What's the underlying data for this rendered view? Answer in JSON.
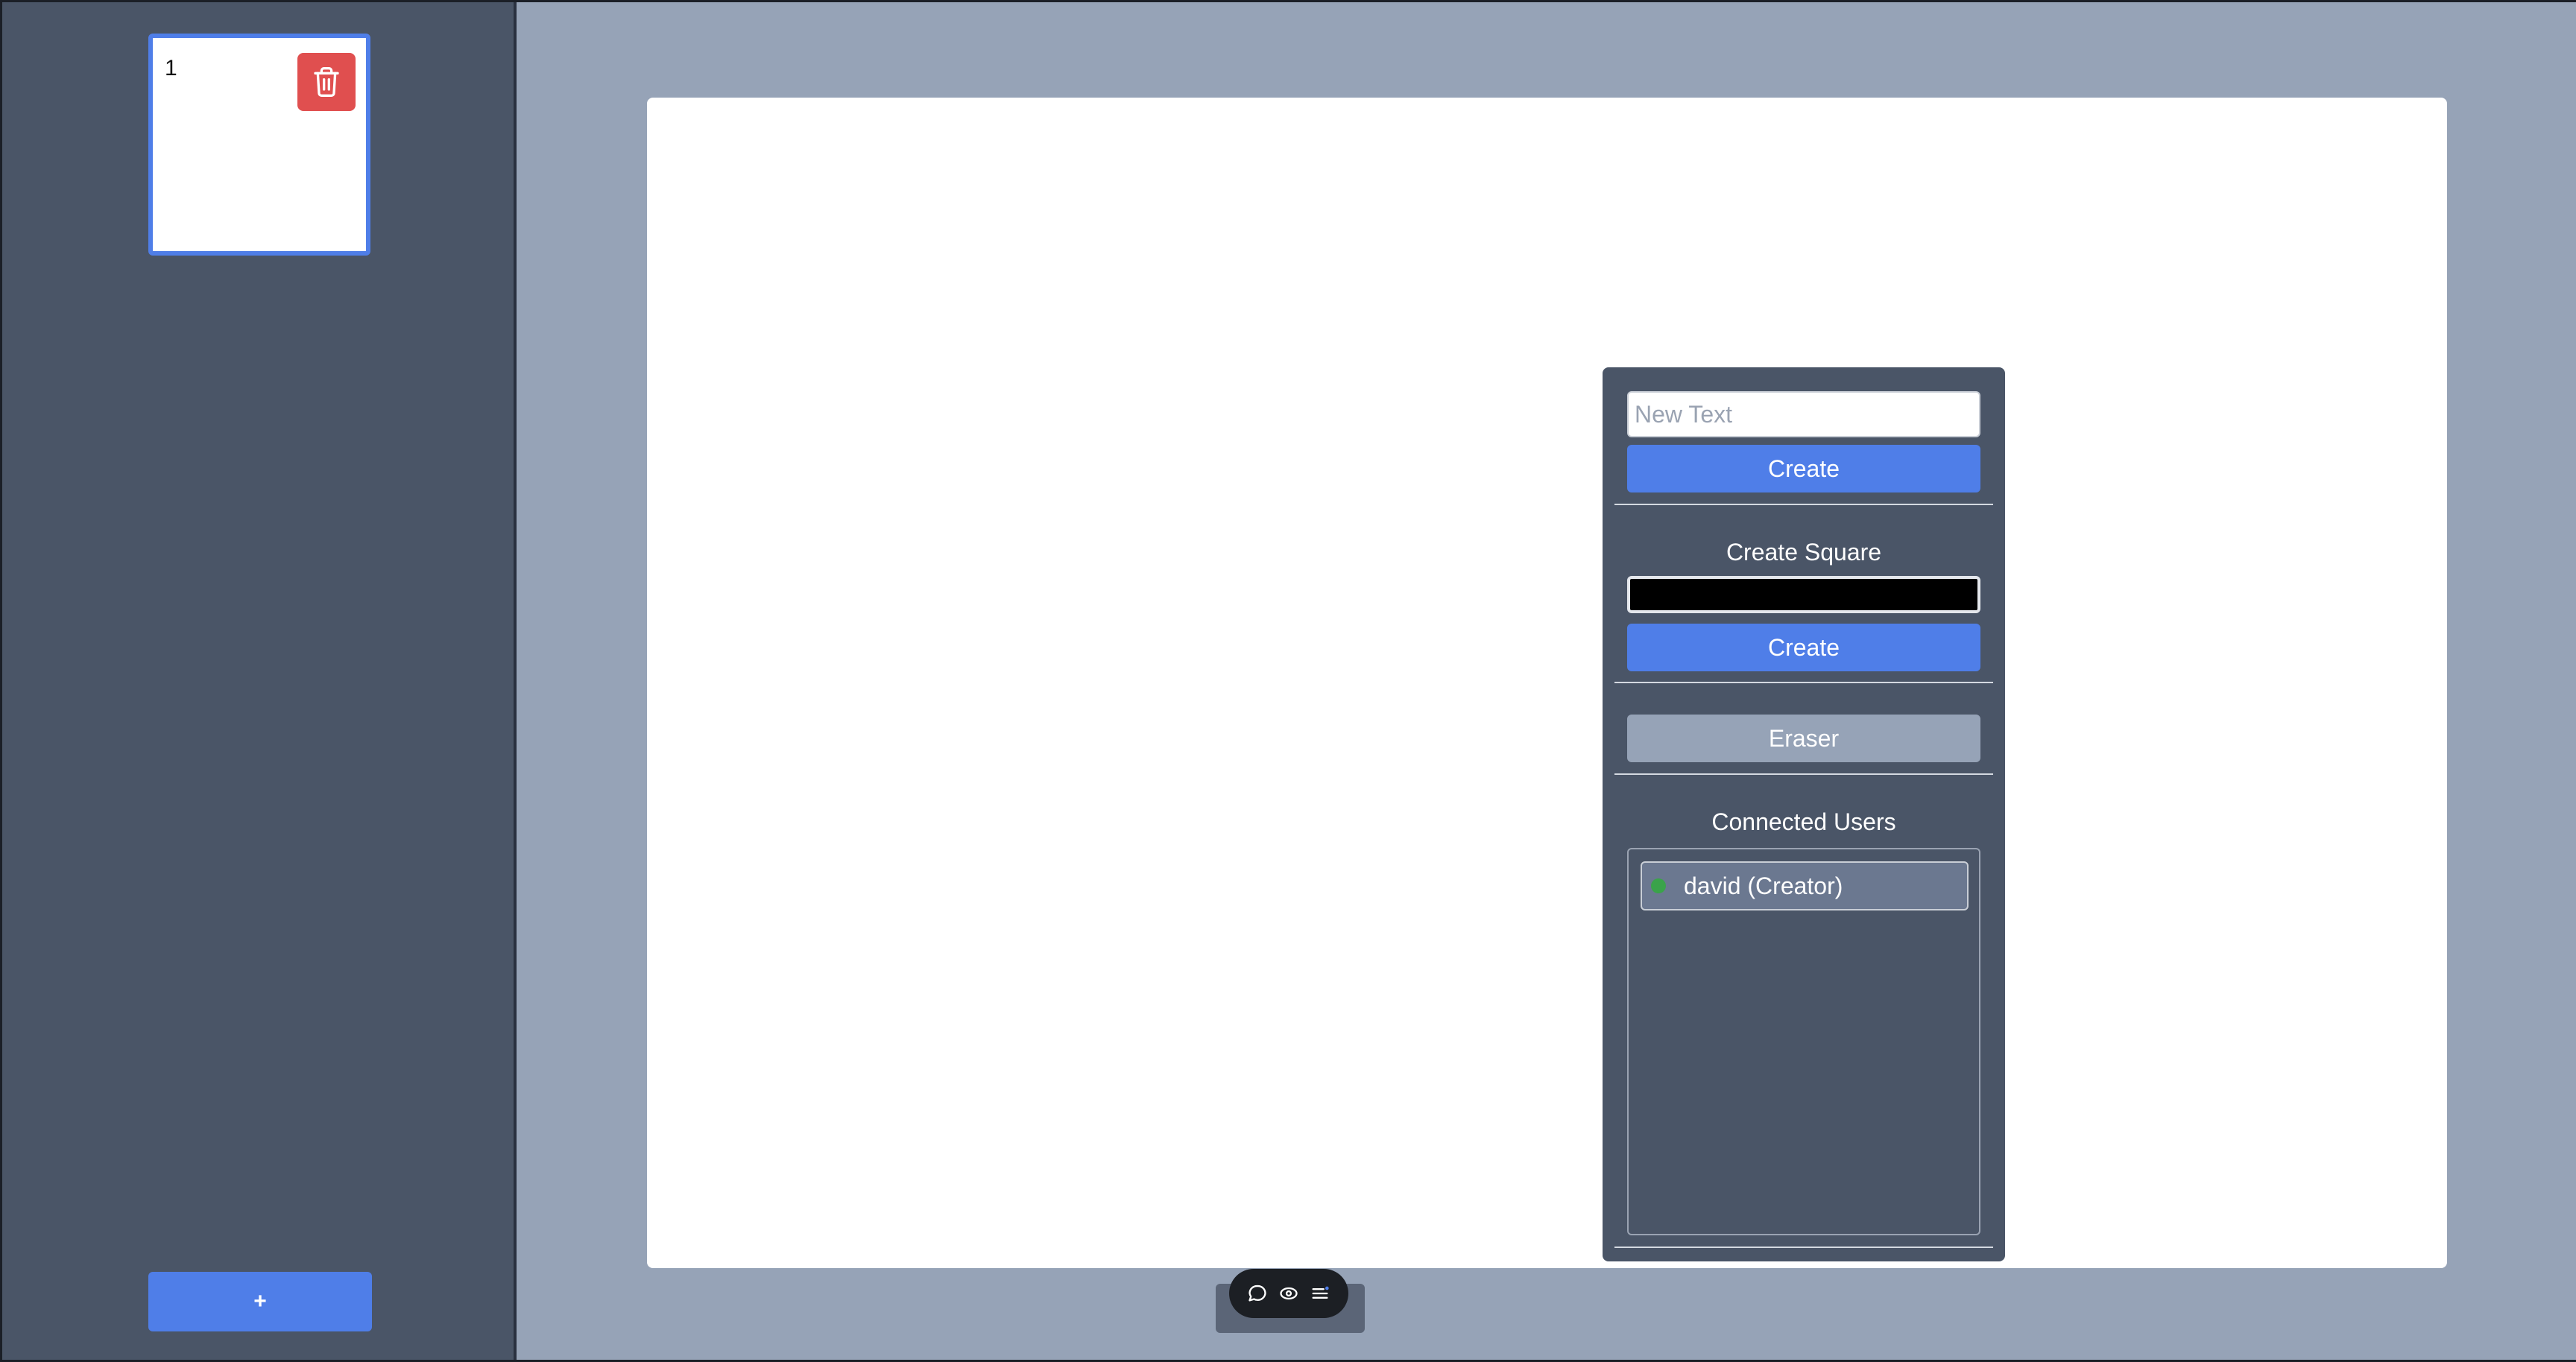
{
  "sidebar": {
    "slides": [
      {
        "number": "1",
        "delete_icon": "trash-icon"
      }
    ],
    "add_slide_label": "+"
  },
  "tool_panel": {
    "text_input": {
      "placeholder": "New Text",
      "value": ""
    },
    "create_text_label": "Create",
    "square_section_label": "Create Square",
    "square_color": "#000000",
    "create_square_label": "Create",
    "eraser_label": "Eraser",
    "users_section_label": "Connected Users",
    "users": [
      {
        "name": "david (Creator)",
        "status_color": "#3aa34a"
      }
    ]
  },
  "bottom_toolbar": {
    "icons": [
      "chat-icon",
      "eye-icon",
      "menu-icon"
    ]
  },
  "colors": {
    "accent": "#4f7ee8",
    "danger": "#e04f4f",
    "panel": "#4a5567",
    "workspace": "#96a3b7"
  }
}
